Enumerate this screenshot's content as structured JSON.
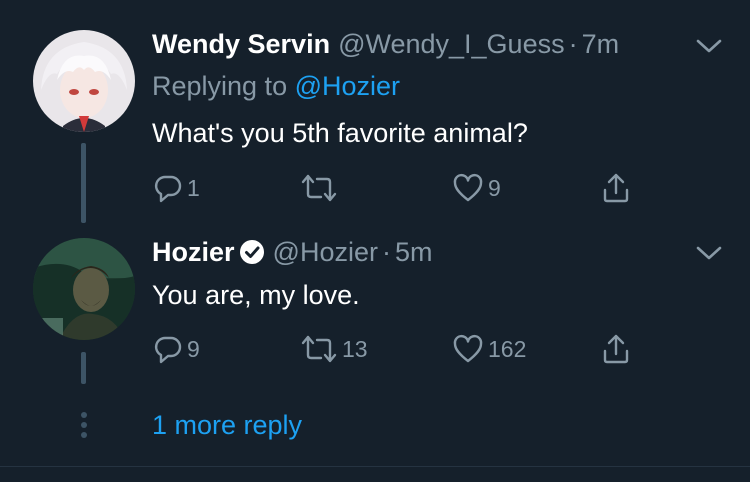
{
  "colors": {
    "background": "#15202b",
    "primary_text": "#ffffff",
    "secondary_text": "#8899a6",
    "link": "#1da1f2",
    "thread_line": "#3d5466"
  },
  "tweets": [
    {
      "name": "Wendy Servin",
      "handle": "@Wendy_I_Guess",
      "separator": "·",
      "time": "7m",
      "replying_prefix": "Replying to",
      "replying_to": "@Hozier",
      "text": "What's you 5th favorite animal?",
      "verified": false,
      "actions": {
        "reply_count": "1",
        "retweet_count": "",
        "like_count": "9"
      }
    },
    {
      "name": "Hozier",
      "handle": "@Hozier",
      "separator": "·",
      "time": "5m",
      "text": "You are, my love.",
      "verified": true,
      "actions": {
        "reply_count": "9",
        "retweet_count": "13",
        "like_count": "162"
      }
    }
  ],
  "more_replies_label": "1 more reply",
  "icons": [
    "reply-icon",
    "retweet-icon",
    "like-icon",
    "share-icon",
    "chevron-down-icon",
    "verified-badge-icon"
  ]
}
